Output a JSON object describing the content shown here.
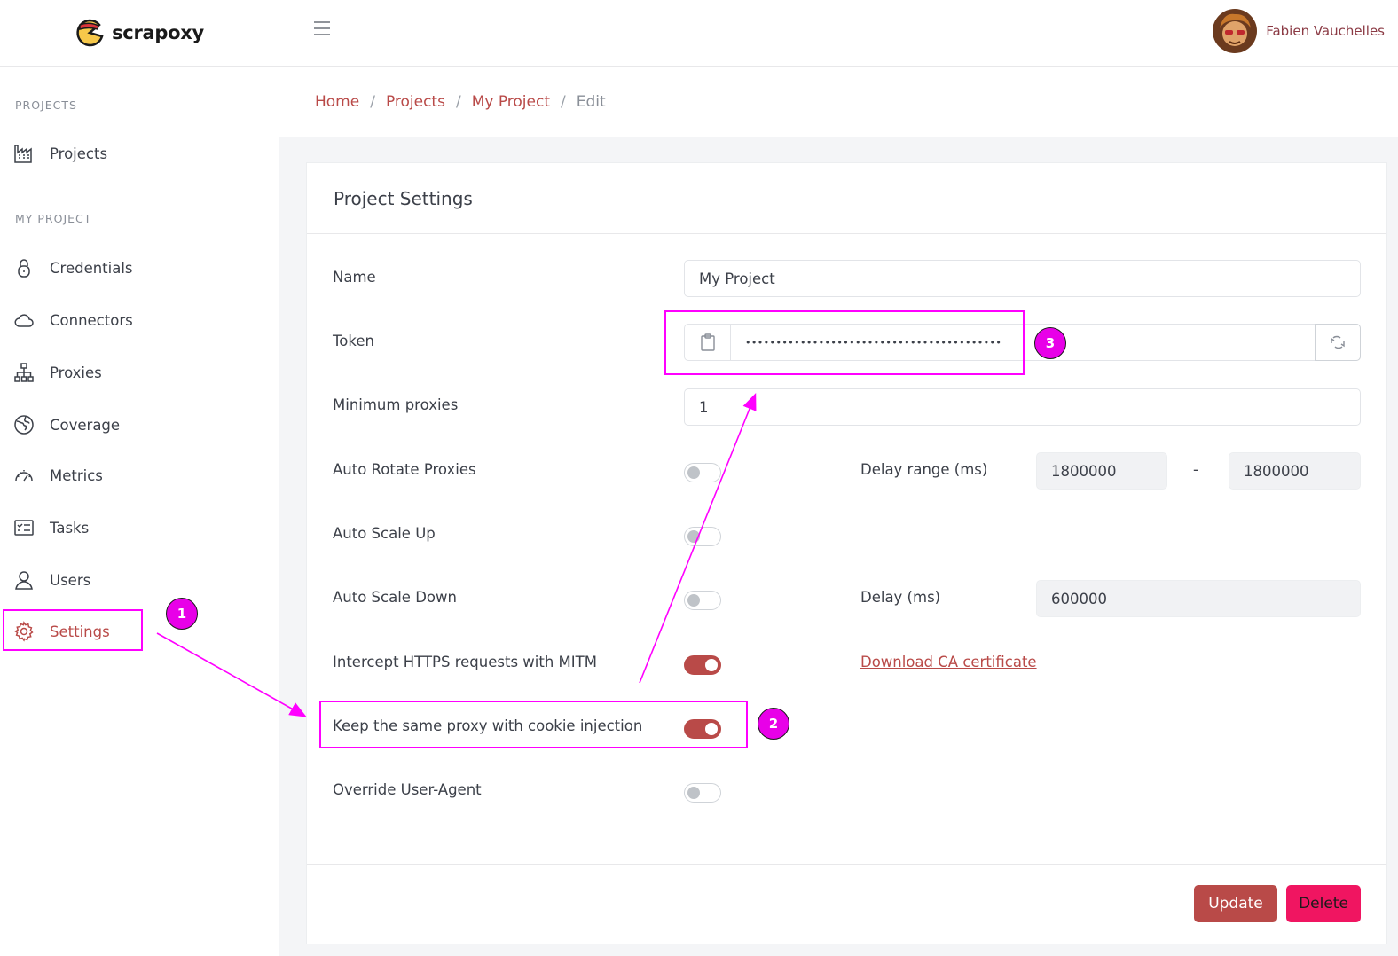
{
  "brand": {
    "name": "scrapoxy"
  },
  "user": {
    "name": "Fabien Vauchelles"
  },
  "sidebar": {
    "section_projects": "PROJECTS",
    "section_my_project": "MY PROJECT",
    "items": [
      {
        "label": "Projects"
      },
      {
        "label": "Credentials"
      },
      {
        "label": "Connectors"
      },
      {
        "label": "Proxies"
      },
      {
        "label": "Coverage"
      },
      {
        "label": "Metrics"
      },
      {
        "label": "Tasks"
      },
      {
        "label": "Users"
      },
      {
        "label": "Settings"
      }
    ]
  },
  "breadcrumb": {
    "home": "Home",
    "projects": "Projects",
    "project": "My Project",
    "current": "Edit",
    "separator": "/"
  },
  "card": {
    "title": "Project Settings"
  },
  "form": {
    "name_label": "Name",
    "name_value": "My Project",
    "token_label": "Token",
    "token_value": "••••••••••••••••••••••••••••••••••••••••••",
    "min_proxies_label": "Minimum proxies",
    "min_proxies_value": "1",
    "auto_rotate_label": "Auto Rotate Proxies",
    "auto_rotate_on": false,
    "delay_range_label": "Delay range (ms)",
    "delay_range_min": "1800000",
    "delay_range_sep": "-",
    "delay_range_max": "1800000",
    "auto_scale_up_label": "Auto Scale Up",
    "auto_scale_up_on": false,
    "auto_scale_down_label": "Auto Scale Down",
    "auto_scale_down_on": false,
    "delay_label": "Delay (ms)",
    "delay_value": "600000",
    "mitm_label": "Intercept HTTPS requests with MITM",
    "mitm_on": true,
    "download_ca_link": "Download CA certificate",
    "cookie_label": "Keep the same proxy with cookie injection",
    "cookie_on": true,
    "override_ua_label": "Override User-Agent",
    "override_ua_on": false
  },
  "buttons": {
    "update": "Update",
    "delete": "Delete"
  },
  "annotations": {
    "n1": "1",
    "n2": "2",
    "n3": "3"
  },
  "colors": {
    "accent": "#b94a48",
    "delete": "#f01561",
    "annotation": "#ff00ff"
  }
}
